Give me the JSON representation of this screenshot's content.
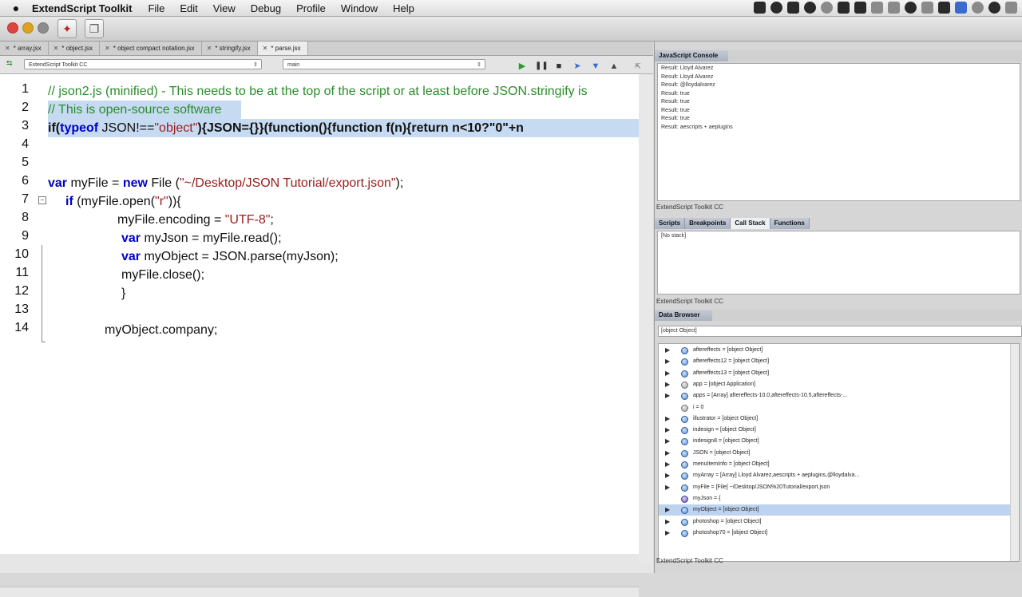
{
  "menubar": {
    "apple": "",
    "app_name": "ExtendScript Toolkit",
    "items": [
      "File",
      "Edit",
      "View",
      "Debug",
      "Profile",
      "Window",
      "Help"
    ]
  },
  "tabs": [
    {
      "label": "* array.jsx"
    },
    {
      "label": "* object.jsx"
    },
    {
      "label": "* object compact notation.jsx"
    },
    {
      "label": "* stringify.jsx"
    },
    {
      "label": "* parse.jsx",
      "active": true
    }
  ],
  "target": {
    "app": "ExtendScript Toolkit CC",
    "engine": "main"
  },
  "debug_icons": [
    "play-icon",
    "pause-icon",
    "stop-icon",
    "step-over-icon",
    "step-into-icon",
    "step-out-icon"
  ],
  "editor": {
    "line_numbers": [
      "1",
      "2",
      "3",
      "4",
      "5",
      "6",
      "7",
      "8",
      "9",
      "10",
      "11",
      "12",
      "13",
      "14"
    ],
    "line1": "// json2.js (minified) - This needs to be at the top of the script or at least before JSON.stringify is",
    "line2": "// This is open-source software",
    "line3_a": "if(",
    "line3_b": "typeof",
    "line3_c": " JSON!==",
    "line3_d": "\"object\"",
    "line3_e": "){JSON={}}(function(){function f(n){return n<10?\"0\"+n",
    "line6_a": "var",
    "line6_b": " myFile = ",
    "line6_c": "new",
    "line6_d": " File (",
    "line6_e": "\"~/Desktop/JSON Tutorial/export.json\"",
    "line6_f": ");",
    "line7_a": "if",
    "line7_b": " (myFile.open(",
    "line7_c": "\"r\"",
    "line7_d": ")){",
    "line8_a": "myFile.encoding = ",
    "line8_b": "\"UTF-8\"",
    "line8_c": ";",
    "line9_a": "var",
    "line9_b": " myJson = myFile.read();",
    "line10_a": "var",
    "line10_b": " myObject = JSON.parse(myJson);",
    "line11": "myFile.close();",
    "line12": "}",
    "line14": "myObject.company;"
  },
  "console": {
    "title": "JavaScript Console",
    "lines": [
      "Result: Lloyd Alvarez",
      "Result: Lloyd Alvarez",
      "Result: @lloydalvarez",
      "Result: true",
      "Result: true",
      "Result: true",
      "Result: true",
      "Result: aescripts + aeplugins"
    ],
    "status": "ExtendScript Toolkit CC"
  },
  "debug_panel": {
    "tabs": [
      "Scripts",
      "Breakpoints",
      "Call Stack",
      "Functions"
    ],
    "active_tab": "Call Stack",
    "content": "[No stack]",
    "status": "ExtendScript Toolkit CC"
  },
  "data_browser": {
    "title": "Data Browser",
    "field": "[object Object]",
    "items": [
      {
        "text": "aftereffects = [object Object]",
        "expandable": true,
        "icon": "object-icon"
      },
      {
        "text": "aftereffects12 = [object Object]",
        "expandable": true,
        "icon": "object-icon"
      },
      {
        "text": "aftereffects13 = [object Object]",
        "expandable": true,
        "icon": "object-icon"
      },
      {
        "text": "app = [object Application]",
        "expandable": true,
        "icon": "application-icon"
      },
      {
        "text": "apps = [Array] aftereffects-10.0,aftereffects-10.5,aftereffects-...",
        "expandable": true,
        "icon": "object-icon"
      },
      {
        "text": "i = 0",
        "expandable": false,
        "icon": "number-icon"
      },
      {
        "text": "illustrator = [object Object]",
        "expandable": true,
        "icon": "object-icon"
      },
      {
        "text": "indesign = [object Object]",
        "expandable": true,
        "icon": "object-icon"
      },
      {
        "text": "indesign8 = [object Object]",
        "expandable": true,
        "icon": "object-icon"
      },
      {
        "text": "JSON = [object Object]",
        "expandable": true,
        "icon": "object-icon"
      },
      {
        "text": "menuItemInfo = [object Object]",
        "expandable": true,
        "icon": "object-icon"
      },
      {
        "text": "myArray = [Array] Lloyd Alvarez,aescripts + aeplugins,@lloydalva...",
        "expandable": true,
        "icon": "object-icon"
      },
      {
        "text": "myFile = [File] ~/Desktop/JSON%20Tutorial/export.json",
        "expandable": true,
        "icon": "object-icon"
      },
      {
        "text": "myJson = {",
        "expandable": false,
        "icon": "string-icon"
      },
      {
        "text": "myObject = [object Object]",
        "expandable": true,
        "icon": "object-icon",
        "selected": true
      },
      {
        "text": "photoshop = [object Object]",
        "expandable": true,
        "icon": "object-icon"
      },
      {
        "text": "photoshop70 = [object Object]",
        "expandable": true,
        "icon": "object-icon"
      }
    ],
    "status": "ExtendScript Toolkit CC"
  }
}
